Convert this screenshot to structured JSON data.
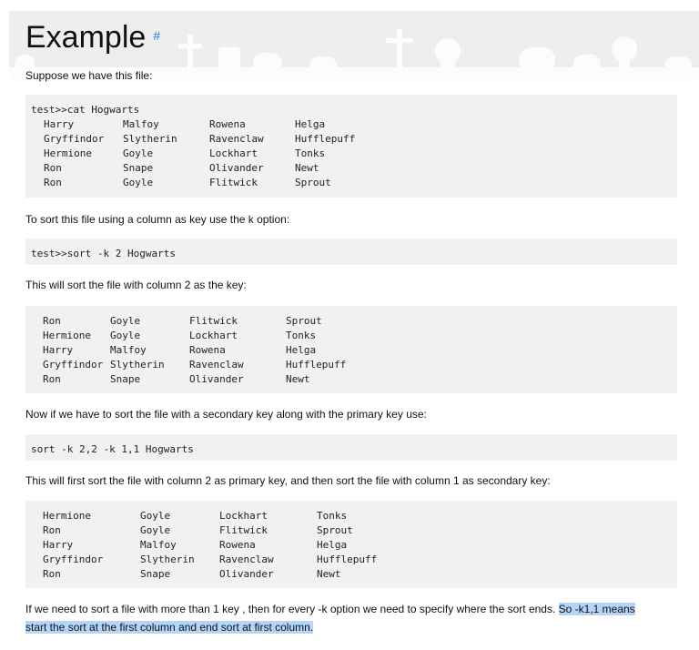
{
  "heading": {
    "title": "Example",
    "anchor": "#"
  },
  "intro": "Suppose we have this file:",
  "block1": {
    "command": "test>>cat Hogwarts",
    "rows": [
      [
        "Harry",
        "Malfoy",
        "Rowena",
        "Helga"
      ],
      [
        "Gryffindor",
        "Slytherin",
        "Ravenclaw",
        "Hufflepuff"
      ],
      [
        "Hermione",
        "Goyle",
        "Lockhart",
        "Tonks"
      ],
      [
        "Ron",
        "Snape",
        "Olivander",
        "Newt"
      ],
      [
        "Ron",
        "Goyle",
        "Flitwick",
        "Sprout"
      ]
    ]
  },
  "text2": "To sort this file using a column as key use the k option:",
  "block2": {
    "command": "test>>sort -k 2 Hogwarts"
  },
  "text3": "This will sort the file with column 2 as the key:",
  "block3": {
    "rows": [
      [
        "Ron",
        "Goyle",
        "Flitwick",
        "Sprout"
      ],
      [
        "Hermione",
        "Goyle",
        "Lockhart",
        "Tonks"
      ],
      [
        "Harry",
        "Malfoy",
        "Rowena",
        "Helga"
      ],
      [
        "Gryffindor",
        "Slytherin",
        "Ravenclaw",
        "Hufflepuff"
      ],
      [
        "Ron",
        "Snape",
        "Olivander",
        "Newt"
      ]
    ]
  },
  "text4": "Now if we have to sort the file with a secondary key along with the primary key use:",
  "block4": {
    "command": "sort -k 2,2 -k 1,1 Hogwarts"
  },
  "text5": "This will first sort the file with column 2 as primary key, and then sort the file with column 1 as secondary key:",
  "block5": {
    "rows": [
      [
        "Hermione",
        "Goyle",
        "Lockhart",
        "Tonks"
      ],
      [
        "Ron",
        "Goyle",
        "Flitwick",
        "Sprout"
      ],
      [
        "Harry",
        "Malfoy",
        "Rowena",
        "Helga"
      ],
      [
        "Gryffindor",
        "Slytherin",
        "Ravenclaw",
        "Hufflepuff"
      ],
      [
        "Ron",
        "Snape",
        "Olivander",
        "Newt"
      ]
    ]
  },
  "text6": {
    "plain": "If we need to sort a file with more than 1 key , then for every -k option we need to specify where the sort ends. ",
    "highlight_line1": "So -k1,1 means",
    "highlight_line2": "start the sort at the first column and end sort at first column."
  },
  "colors": {
    "code_bg": "#f1f1f1",
    "selection": "#b5d5f7",
    "anchor": "#2a7ae2"
  }
}
